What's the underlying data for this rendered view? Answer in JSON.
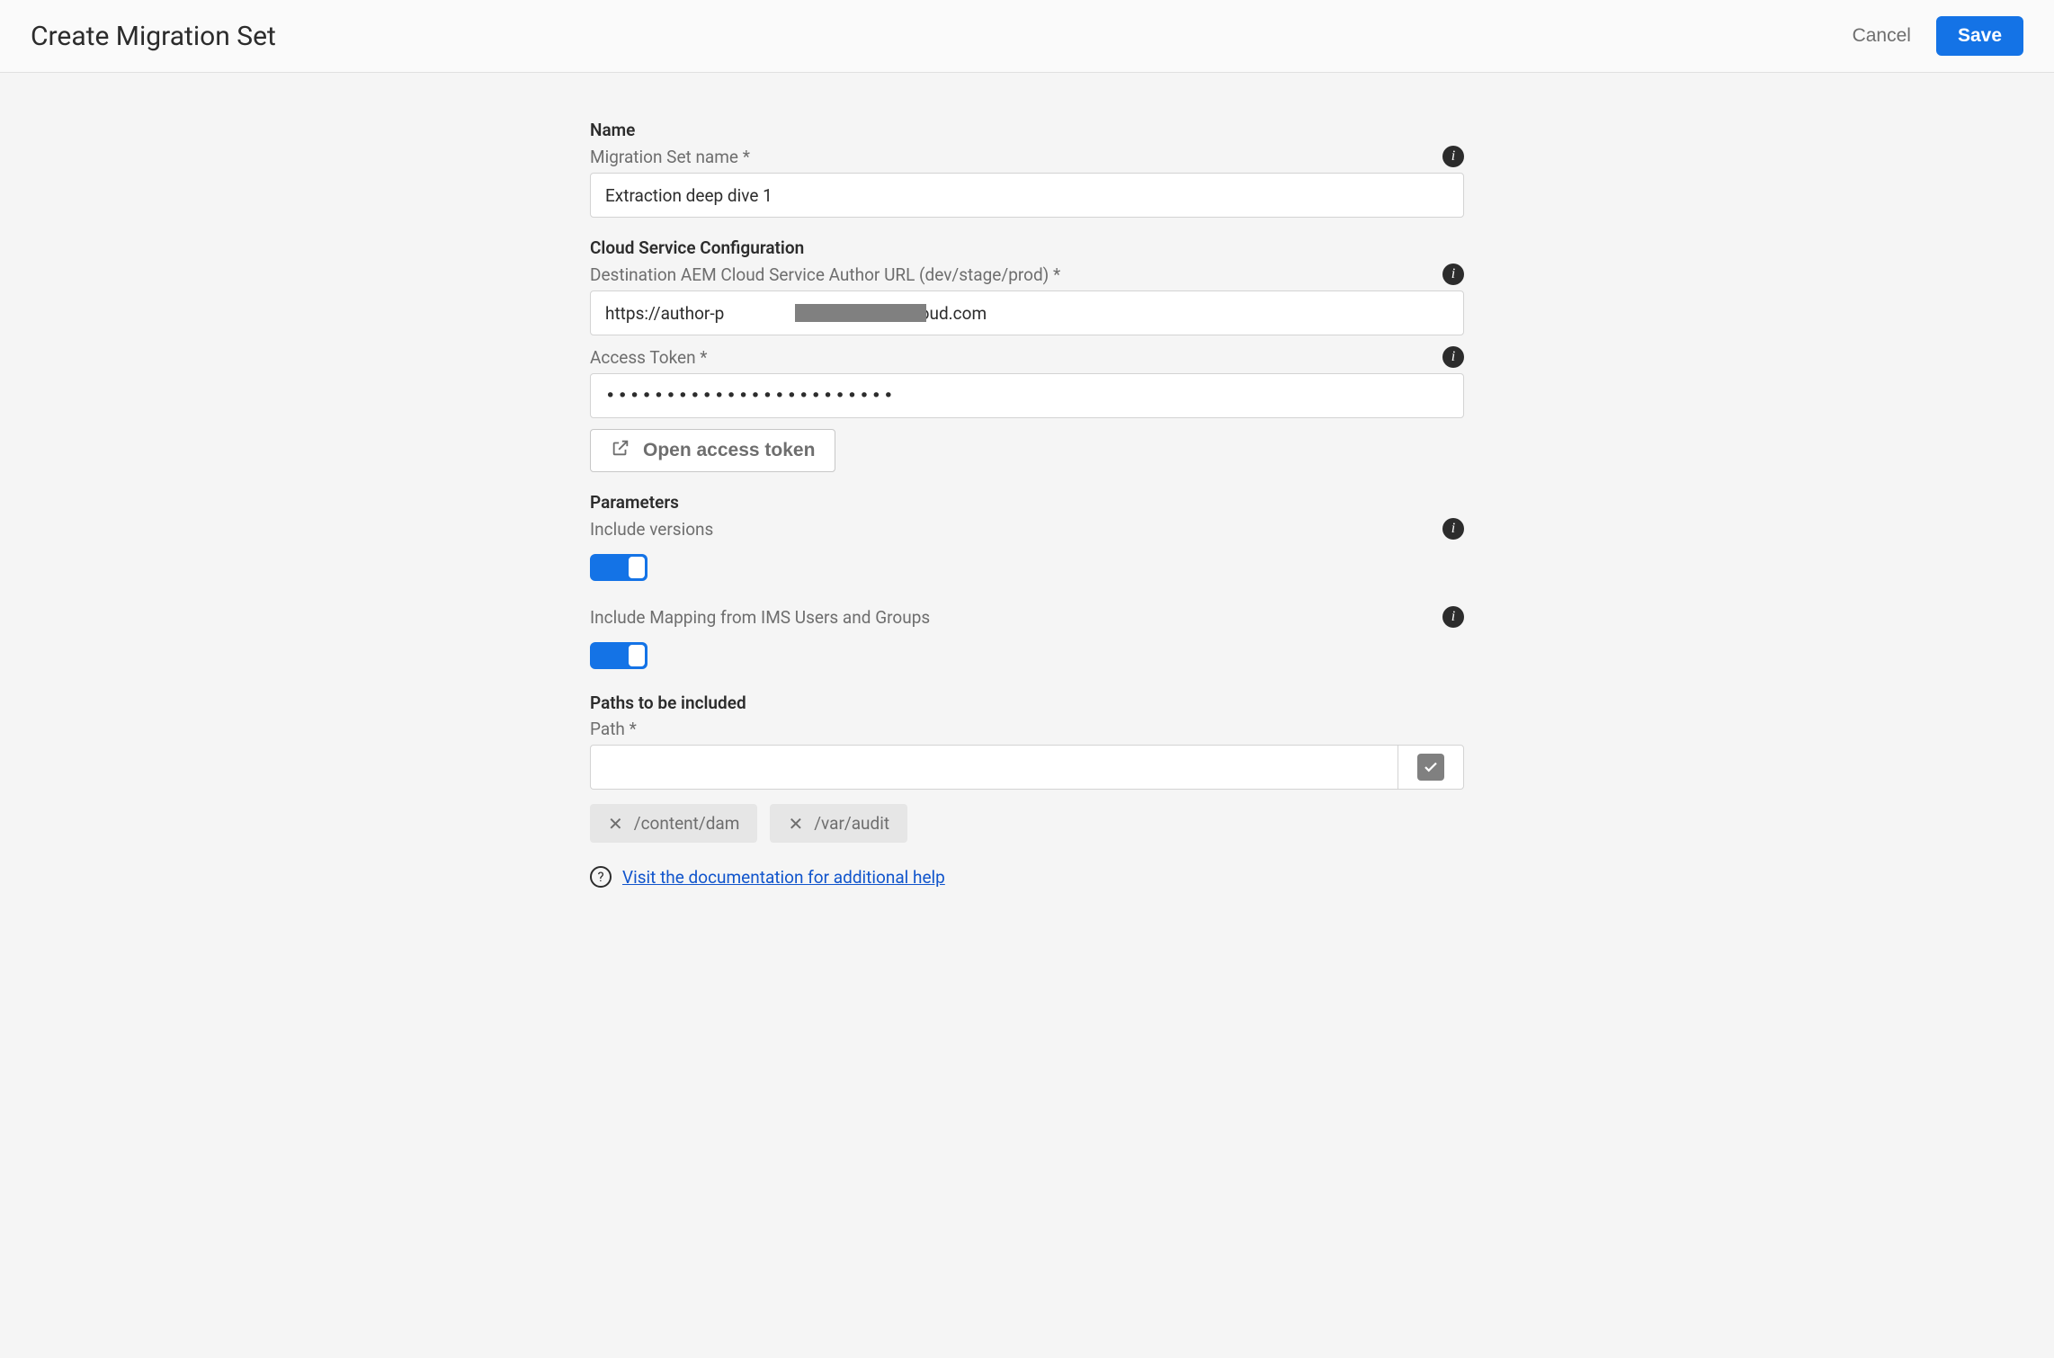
{
  "header": {
    "title": "Create Migration Set",
    "cancel_label": "Cancel",
    "save_label": "Save"
  },
  "sections": {
    "name_title": "Name",
    "cloud_title": "Cloud Service Configuration",
    "params_title": "Parameters",
    "paths_title": "Paths to be included"
  },
  "fields": {
    "name_label": "Migration Set name *",
    "name_value": "Extraction deep dive 1",
    "url_label": "Destination AEM Cloud Service Author URL (dev/stage/prod) *",
    "url_value": "https://author-p                        adobeaemcloud.com",
    "token_label": "Access Token *",
    "token_value": "••••••••••••••••••••••••",
    "open_token_label": "Open access token",
    "include_versions_label": "Include versions",
    "include_versions_on": true,
    "include_mapping_label": "Include Mapping from IMS Users and Groups",
    "include_mapping_on": true,
    "path_label": "Path *",
    "path_value": ""
  },
  "chips": [
    "/content/dam",
    "/var/audit"
  ],
  "help": {
    "text": "Visit the documentation for additional help"
  },
  "icons": {
    "info_glyph": "i",
    "help_glyph": "?",
    "close_glyph": "✕"
  }
}
